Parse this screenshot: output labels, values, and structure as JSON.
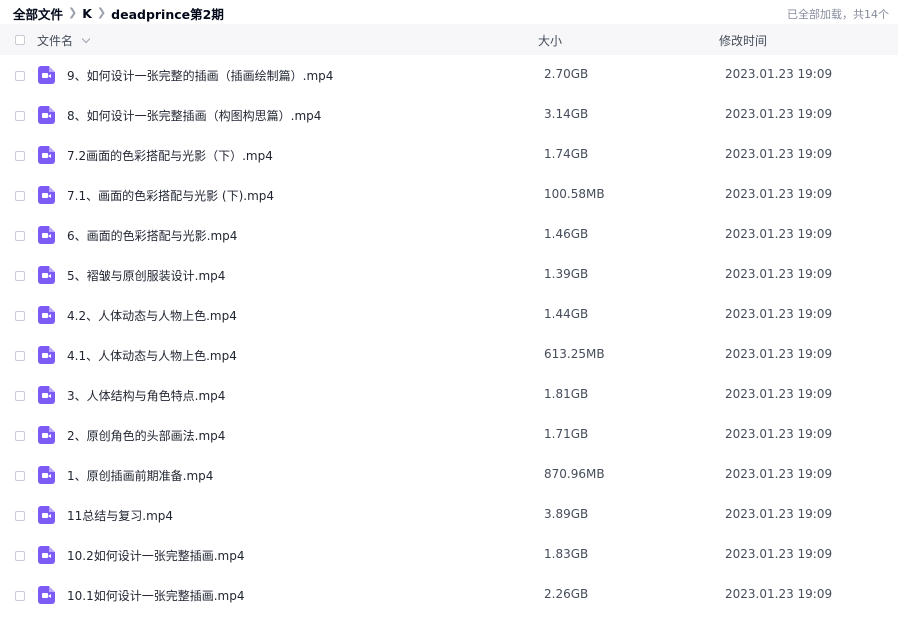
{
  "breadcrumb": {
    "items": [
      "全部文件",
      "K",
      "deadprince第2期"
    ]
  },
  "status": "已全部加载，共14个",
  "columns": {
    "name": "文件名",
    "size": "大小",
    "modified": "修改时间"
  },
  "icons": {
    "file_type": "video-file-icon",
    "sort": "chevron-down-icon",
    "separator": "chevron-right-icon"
  },
  "colors": {
    "video_icon": "#7d5cf5",
    "header_bg": "#f7f7f9"
  },
  "files": [
    {
      "name": "9、如何设计一张完整的插画（插画绘制篇）.mp4",
      "size": "2.70GB",
      "modified": "2023.01.23 19:09"
    },
    {
      "name": "8、如何设计一张完整插画（构图构思篇）.mp4",
      "size": "3.14GB",
      "modified": "2023.01.23 19:09"
    },
    {
      "name": "7.2画面的色彩搭配与光影（下）.mp4",
      "size": "1.74GB",
      "modified": "2023.01.23 19:09"
    },
    {
      "name": "7.1、画面的色彩搭配与光影 (下).mp4",
      "size": "100.58MB",
      "modified": "2023.01.23 19:09"
    },
    {
      "name": "6、画面的色彩搭配与光影.mp4",
      "size": "1.46GB",
      "modified": "2023.01.23 19:09"
    },
    {
      "name": "5、褶皱与原创服装设计.mp4",
      "size": "1.39GB",
      "modified": "2023.01.23 19:09"
    },
    {
      "name": "4.2、人体动态与人物上色.mp4",
      "size": "1.44GB",
      "modified": "2023.01.23 19:09"
    },
    {
      "name": "4.1、人体动态与人物上色.mp4",
      "size": "613.25MB",
      "modified": "2023.01.23 19:09"
    },
    {
      "name": "3、人体结构与角色特点.mp4",
      "size": "1.81GB",
      "modified": "2023.01.23 19:09"
    },
    {
      "name": "2、原创角色的头部画法.mp4",
      "size": "1.71GB",
      "modified": "2023.01.23 19:09"
    },
    {
      "name": "1、原创插画前期准备.mp4",
      "size": "870.96MB",
      "modified": "2023.01.23 19:09"
    },
    {
      "name": "11总结与复习.mp4",
      "size": "3.89GB",
      "modified": "2023.01.23 19:09"
    },
    {
      "name": "10.2如何设计一张完整插画.mp4",
      "size": "1.83GB",
      "modified": "2023.01.23 19:09"
    },
    {
      "name": "10.1如何设计一张完整插画.mp4",
      "size": "2.26GB",
      "modified": "2023.01.23 19:09"
    }
  ]
}
